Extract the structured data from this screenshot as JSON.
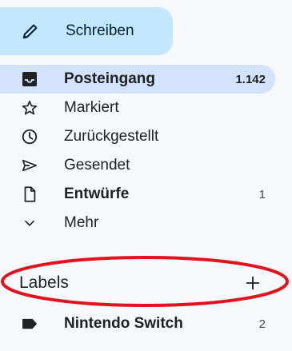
{
  "compose": {
    "label": "Schreiben",
    "icon": "pencil-icon"
  },
  "nav": {
    "items": [
      {
        "label": "Posteingang",
        "count": "1.142",
        "icon": "inbox-icon",
        "bold": true,
        "active": true
      },
      {
        "label": "Markiert",
        "count": "",
        "icon": "star-icon",
        "bold": false,
        "active": false
      },
      {
        "label": "Zurückgestellt",
        "count": "",
        "icon": "clock-icon",
        "bold": false,
        "active": false
      },
      {
        "label": "Gesendet",
        "count": "",
        "icon": "send-icon",
        "bold": false,
        "active": false
      },
      {
        "label": "Entwürfe",
        "count": "1",
        "icon": "draft-icon",
        "bold": true,
        "active": false
      },
      {
        "label": "Mehr",
        "count": "",
        "icon": "chevron-down-icon",
        "bold": false,
        "active": false
      }
    ]
  },
  "labels": {
    "title": "Labels",
    "add_icon": "plus-icon",
    "items": [
      {
        "label": "Nintendo Switch",
        "count": "2",
        "icon": "label-icon"
      }
    ]
  },
  "annotation": {
    "color": "#e0141e"
  },
  "colors": {
    "compose_bg": "#c2e7ff",
    "active_bg": "#d3e3fd",
    "page_bg": "#f6f8fc"
  }
}
